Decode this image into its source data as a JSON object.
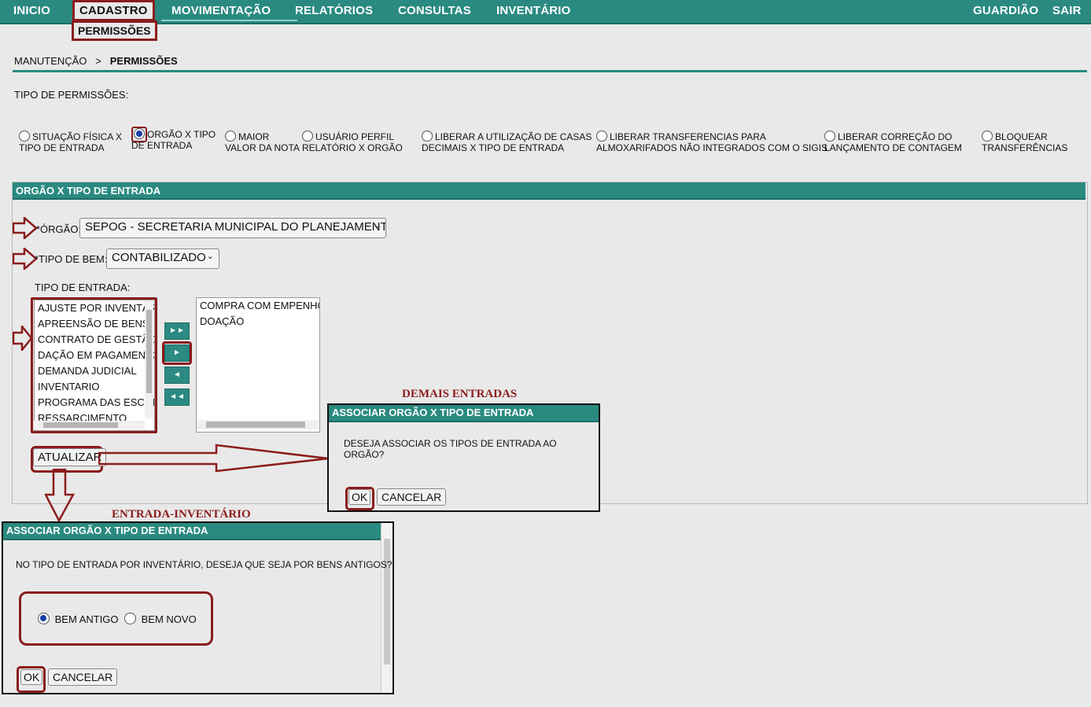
{
  "nav": {
    "items": [
      "INICIO",
      "CADASTRO",
      "MOVIMENTAÇÃO",
      "RELATÓRIOS",
      "CONSULTAS",
      "INVENTÁRIO"
    ],
    "right_items": [
      "GUARDIÃO",
      "SAIR"
    ],
    "submenu_item": "PERMISSÕES"
  },
  "breadcrumb": {
    "parent": "MANUTENÇÃO",
    "separator": ">",
    "current": "PERMISSÕES"
  },
  "permissions": {
    "title": "TIPO DE PERMISSÕES:",
    "options": [
      {
        "line1": "SITUAÇÃO FÍSICA X",
        "line2": "TIPO DE ENTRADA",
        "selected": false
      },
      {
        "line1": "ORGÃO X TIPO",
        "line2": "DE ENTRADA",
        "selected": true
      },
      {
        "line1": "MAIOR",
        "line2": "VALOR DA NOTA",
        "selected": false
      },
      {
        "line1": "USUÁRIO PERFIL",
        "line2": "RELATÓRIO X ORGÃO",
        "selected": false
      },
      {
        "line1": "LIBERAR A UTILIZAÇÃO DE CASAS",
        "line2": "DECIMAIS X TIPO DE ENTRADA",
        "selected": false
      },
      {
        "line1": "LIBERAR TRANSFERENCIAS PARA",
        "line2": "ALMOXARIFADOS NÃO INTEGRADOS COM O SIGIS",
        "selected": false
      },
      {
        "line1": "LIBERAR CORREÇÃO DO",
        "line2": "LANÇAMENTO DE CONTAGEM",
        "selected": false
      },
      {
        "line1": "BLOQUEAR",
        "line2": "TRANSFERÊNCIAS",
        "selected": false
      }
    ]
  },
  "section": {
    "title": "ORGÃO X TIPO DE ENTRADA",
    "orgao_label": "*ÓRGÃO:",
    "orgao_value": "SEPOG - SECRETARIA MUNICIPAL DO PLANEJAMENTO,",
    "tipo_bem_label": "*TIPO DE BEM:",
    "tipo_bem_value": "CONTABILIZADO",
    "tipo_entrada_label": "TIPO DE ENTRADA:",
    "available": [
      "AJUSTE POR INVENTÁR",
      "APREENSÃO DE BENS",
      "CONTRATO DE GESTÃO",
      "DAÇÃO EM PAGAMENTO",
      "DEMANDA JUDICIAL",
      "INVENTARIO",
      "PROGRAMA DAS ESCOI",
      "RESSARCIMENTO"
    ],
    "selected": [
      "COMPRA COM EMPENHO",
      "DOAÇÃO"
    ],
    "update_button": "ATUALIZAR"
  },
  "captions": {
    "demais": "DEMAIS ENTRADAS",
    "inventario": "ENTRADA-INVENTÁRIO"
  },
  "dialog1": {
    "title": "ASSOCIAR ORGÃO X TIPO DE ENTRADA",
    "message": "DESEJA ASSOCIAR OS TIPOS DE ENTRADA AO ORGÃO?",
    "ok": "OK",
    "cancel": "CANCELAR"
  },
  "dialog2": {
    "title": "ASSOCIAR ORGÃO X TIPO DE ENTRADA",
    "message": "NO TIPO DE ENTRADA POR INVENTÁRIO, DESEJA QUE SEJA POR BENS ANTIGOS?",
    "option_old": "BEM ANTIGO",
    "option_new": "BEM NOVO",
    "ok": "OK",
    "cancel": "CANCELAR"
  },
  "colors": {
    "teal": "#2a8a80",
    "highlight": "#8b1c1c",
    "radio": "#1a3fa8"
  }
}
